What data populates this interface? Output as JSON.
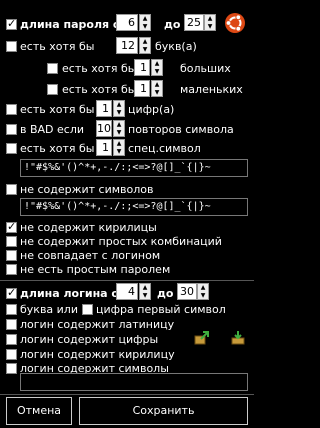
{
  "password": {
    "length_label": "длина пароля от",
    "length_min": "6",
    "length_to": "до",
    "length_max": "25",
    "at_least_label": "есть хотя бы",
    "letters_count": "12",
    "letters_label": "букв(а)",
    "upper_label": "есть хотя бы",
    "upper_count": "1",
    "upper_suffix": "больших",
    "lower_label": "есть хотя бы",
    "lower_count": "1",
    "lower_suffix": "маленьких",
    "digits_label": "есть хотя бы",
    "digits_count": "1",
    "digits_suffix": "цифр(а)",
    "bad_label": "в BAD если",
    "bad_count": "10",
    "bad_suffix": "повторов символа",
    "special_label": "есть хотя бы",
    "special_count": "1",
    "special_suffix": "спец.символ",
    "special_chars": "!\"#$%&'()^*+,-./:;<=>?@[]_`{|}~",
    "not_contain_label": "не содержит символов",
    "not_contain_chars": "!\"#$%&'()^*+,-./:;<=>?@[]_`{|}~",
    "no_cyrillic": "не содержит кирилицы",
    "no_simple_combos": "не содержит простых комбинаций",
    "not_match_login": "не совпадает с логином",
    "not_simple_password": "не есть простым паролем"
  },
  "login": {
    "length_label": "длина логина от",
    "length_min": "4",
    "length_to": "до",
    "length_max": "30",
    "letter_or": "буква или",
    "digit_first": "цифра первый символ",
    "has_latin": "логин содержит латиницу",
    "has_digits": "логин содержит цифры",
    "has_cyrillic": "логин содержит кирилицу",
    "has_symbols": "логин содержит символы",
    "symbols_value": ""
  },
  "buttons": {
    "cancel": "Отмена",
    "save": "Сохранить"
  },
  "icons": [
    "ubuntu-logo-icon",
    "export-icon",
    "import-icon"
  ]
}
